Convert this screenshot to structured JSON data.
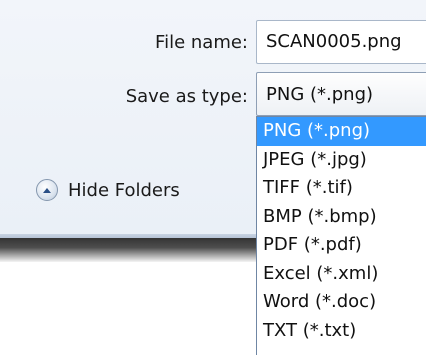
{
  "form": {
    "file_name_label": "File name:",
    "file_name_value": "SCAN0005.png",
    "save_as_type_label": "Save as type:",
    "save_as_type_value": "PNG (*.png)"
  },
  "hide_folders": {
    "label": "Hide Folders",
    "icon": "chevron-up-icon"
  },
  "dropdown": {
    "items": [
      "PNG (*.png)",
      "JPEG (*.jpg)",
      "TIFF (*.tif)",
      "BMP (*.bmp)",
      "PDF (*.pdf)",
      "Excel (*.xml)",
      "Word (*.doc)",
      "TXT (*.txt)"
    ],
    "selected_index": 0,
    "highlight_color": "#3399ff"
  }
}
